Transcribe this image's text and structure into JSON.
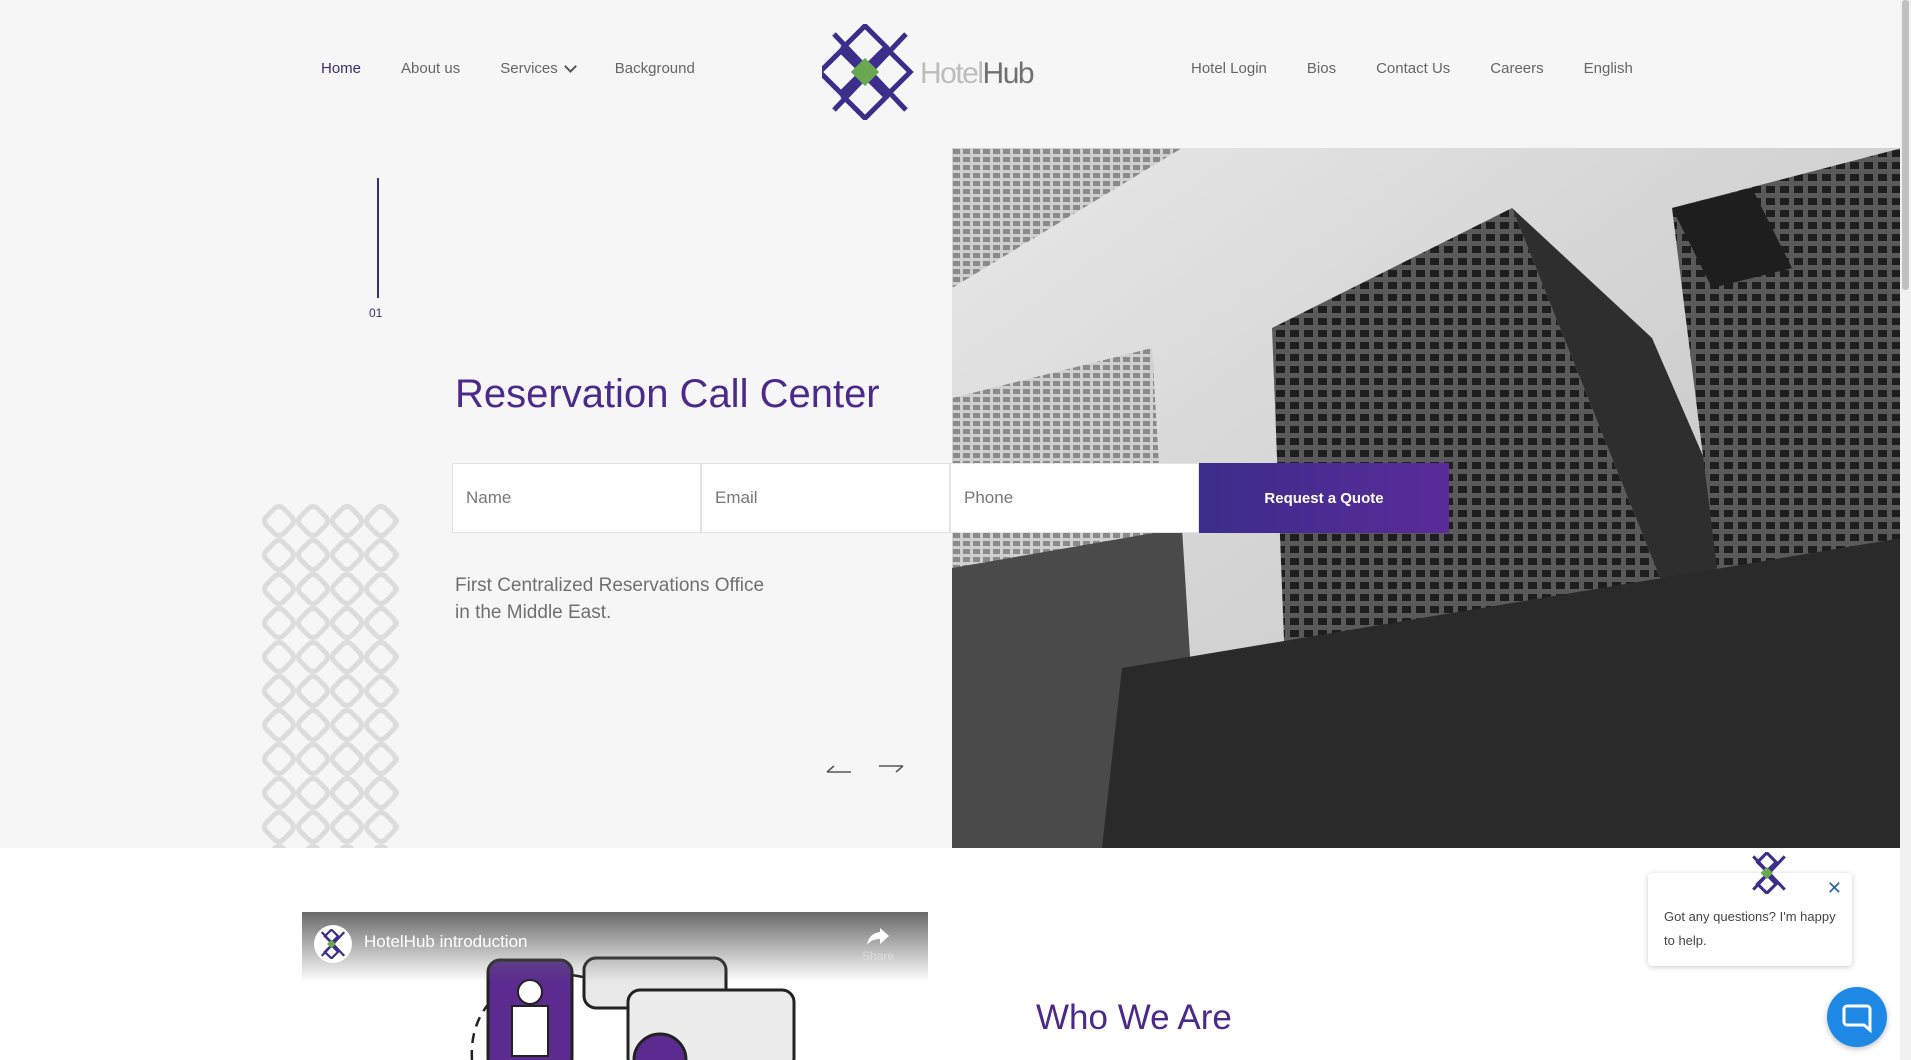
{
  "nav_left": [
    {
      "label": "Home",
      "active": true
    },
    {
      "label": "About us",
      "active": false
    },
    {
      "label": "Services",
      "active": false
    },
    {
      "label": "Background",
      "active": false
    }
  ],
  "nav_right": [
    {
      "label": "Hotel Login"
    },
    {
      "label": "Bios"
    },
    {
      "label": "Contact Us"
    },
    {
      "label": "Careers"
    },
    {
      "label": "English"
    }
  ],
  "logo": {
    "part1": "Hotel",
    "part2": "Hub"
  },
  "hero": {
    "slide_number": "01",
    "title": "Reservation Call Center",
    "subtitle": "First Centralized Reservations Office in the Middle East."
  },
  "form": {
    "name_placeholder": "Name",
    "email_placeholder": "Email",
    "phone_placeholder": "Phone",
    "submit_label": "Request a Quote"
  },
  "video": {
    "title": "HotelHub introduction",
    "share_label": "Share"
  },
  "section_title": "Who We Are",
  "chat": {
    "message": "Got any questions? I'm happy to help."
  },
  "colors": {
    "brand_purple": "#4b2a8a",
    "brand_green": "#6aa84f",
    "chat_blue": "#1e88e5"
  }
}
